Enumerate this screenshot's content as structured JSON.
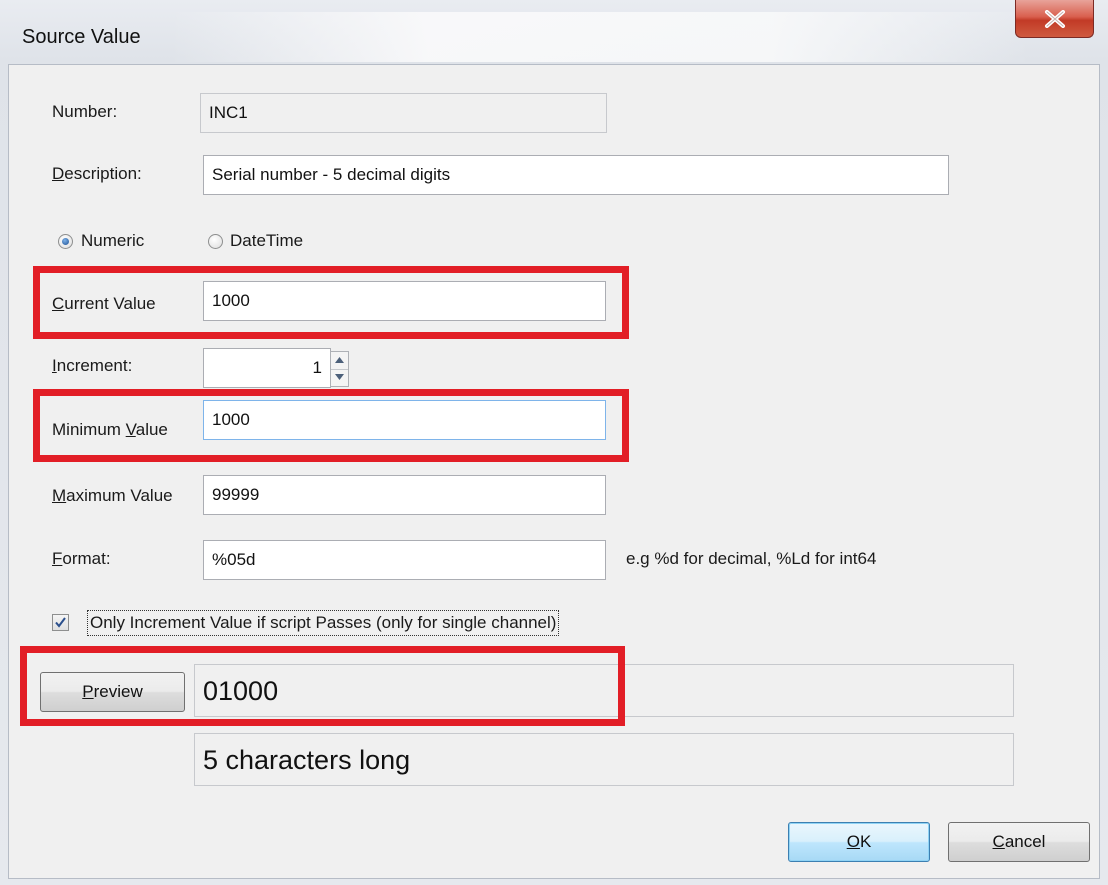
{
  "window": {
    "title": "Source Value",
    "close_glyph": "x"
  },
  "form": {
    "number_label": "Number:",
    "number_value": "INC1",
    "description_label": "Description:",
    "description_value": "Serial number - 5 decimal digits",
    "radio_numeric_label": "Numeric",
    "radio_datetime_label": "DateTime",
    "selected_mode": "Numeric",
    "current_value_label": "Current Value",
    "current_value": "1000",
    "increment_label": "Increment:",
    "increment_value": "1",
    "minimum_label": "Minimum Value",
    "minimum_value": "1000",
    "maximum_label": "Maximum Value",
    "maximum_value": "99999",
    "format_label": "Format:",
    "format_value": "%05d",
    "format_hint": "e.g %d for decimal, %Ld for int64",
    "checkbox_label": "Only Increment Value if script Passes (only for single channel)",
    "checkbox_checked": true
  },
  "preview": {
    "button_label": "Preview",
    "result": "01000",
    "length_text": "5 characters long"
  },
  "buttons": {
    "ok": "OK",
    "cancel": "Cancel"
  },
  "colors": {
    "highlight": "#e21e26",
    "close_button": "#c94631"
  }
}
